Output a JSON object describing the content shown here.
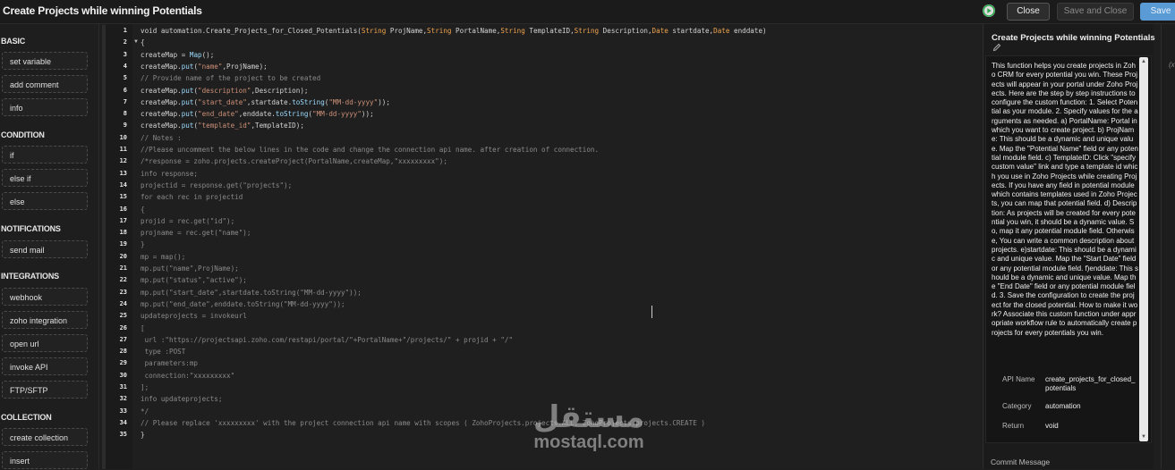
{
  "header": {
    "title": "Create Projects while winning Potentials",
    "close_label": "Close",
    "save_close_label": "Save and Close",
    "save_label": "Save"
  },
  "palette": {
    "sections": [
      {
        "title": "BASIC",
        "items": [
          "set variable",
          "add comment",
          "info"
        ]
      },
      {
        "title": "CONDITION",
        "items": [
          "if",
          "else if",
          "else"
        ]
      },
      {
        "title": "NOTIFICATIONS",
        "items": [
          "send mail"
        ]
      },
      {
        "title": "INTEGRATIONS",
        "items": [
          "webhook",
          "zoho integration",
          "open url",
          "invoke API",
          "FTP/SFTP"
        ]
      },
      {
        "title": "COLLECTION",
        "items": [
          "create collection",
          "insert"
        ]
      }
    ]
  },
  "editor": {
    "lines": [
      "void automation.Create_Projects_for_Closed_Potentials(String ProjName,String PortalName,String TemplateID,String Description,Date startdate,Date enddate)",
      "{",
      "createMap = Map();",
      "createMap.put(\"name\",ProjName);",
      "// Provide name of the project to be created",
      "createMap.put(\"description\",Description);",
      "createMap.put(\"start_date\",startdate.toString(\"MM-dd-yyyy\"));",
      "createMap.put(\"end_date\",enddate.toString(\"MM-dd-yyyy\"));",
      "createMap.put(\"template_id\",TemplateID);",
      "// Notes :",
      "//Please uncomment the below lines in the code and change the connection api name. after creation of connection.",
      "/*response = zoho.projects.createProject(PortalName,createMap,\"xxxxxxxxx\");",
      "info response;",
      "projectid = response.get(\"projects\");",
      "for each rec in projectid",
      "{",
      "projid = rec.get(\"id\");",
      "projname = rec.get(\"name\");",
      "}",
      "mp = map();",
      "mp.put(\"name\",ProjName);",
      "mp.put(\"status\",\"active\");",
      "mp.put(\"start_date\",startdate.toString(\"MM-dd-yyyy\"));",
      "mp.put(\"end_date\",enddate.toString(\"MM-dd-yyyy\"));",
      "updateprojects = invokeurl",
      "[",
      " url :\"https://projectsapi.zoho.com/restapi/portal/\"+PortalName+\"/projects/\" + projid + \"/\"",
      " type :POST",
      " parameters:mp",
      " connection:\"xxxxxxxxx\"",
      "];",
      "info updateprojects;",
      "*/",
      "// Please replace 'xxxxxxxxx' with the project connection api name with scopes ( ZohoProjects.projects.ALL, ZohoProjects.projects.CREATE )",
      "}"
    ]
  },
  "watermark": {
    "arabic": "مستقل",
    "latin": "mostaql.com"
  },
  "details": {
    "title": "Create Projects while winning Potentials",
    "description": "This function helps you create projects in Zoho CRM for every potential you win. These Projects will appear in your portal under Zoho Projects. Here are the step by step instructions to configure the custom function: 1. Select Potential as your module. 2. Specify values for the arguments as needed. a) PortalName: Portal in which you want to create project. b) ProjName: This should be a dynamic and unique value. Map the \"Potential Name\" field or any potential module field. c) TemplateID: Click \"specify custom value\" link and type a template id which you use in Zoho Projects while creating Projects. If you have any field in potential module which contains templates used in Zoho Projects, you can map that potential field. d) Description: As projects will be created for every potential you win, it should be a dynamic value. So, map it any potential module field. Otherwise, You can write a common description about projects. e)startdate: This should be a dynamic and unique value. Map the \"Start Date\" field or any potential module field. f)enddate: This should be a dynamic and unique value. Map the \"End Date\" field or any potential module field. 3. Save the configuration to create the project for the closed potential. How to make it work? Associate this custom function under appropriate workflow rule to automatically create projects for every potentials you win.",
    "api_name_label": "API Name",
    "api_name_value": "create_projects_for_closed_potentials",
    "category_label": "Category",
    "category_value": "automation",
    "return_label": "Return",
    "return_value": "void",
    "commit_label": "Commit Message",
    "side_label": "(x"
  },
  "colors": {
    "save": "#5b9bd5",
    "type": "#f0a44e",
    "function": "#9cdcfe",
    "string": "#ce9178",
    "comment": "#8a8a8a"
  }
}
